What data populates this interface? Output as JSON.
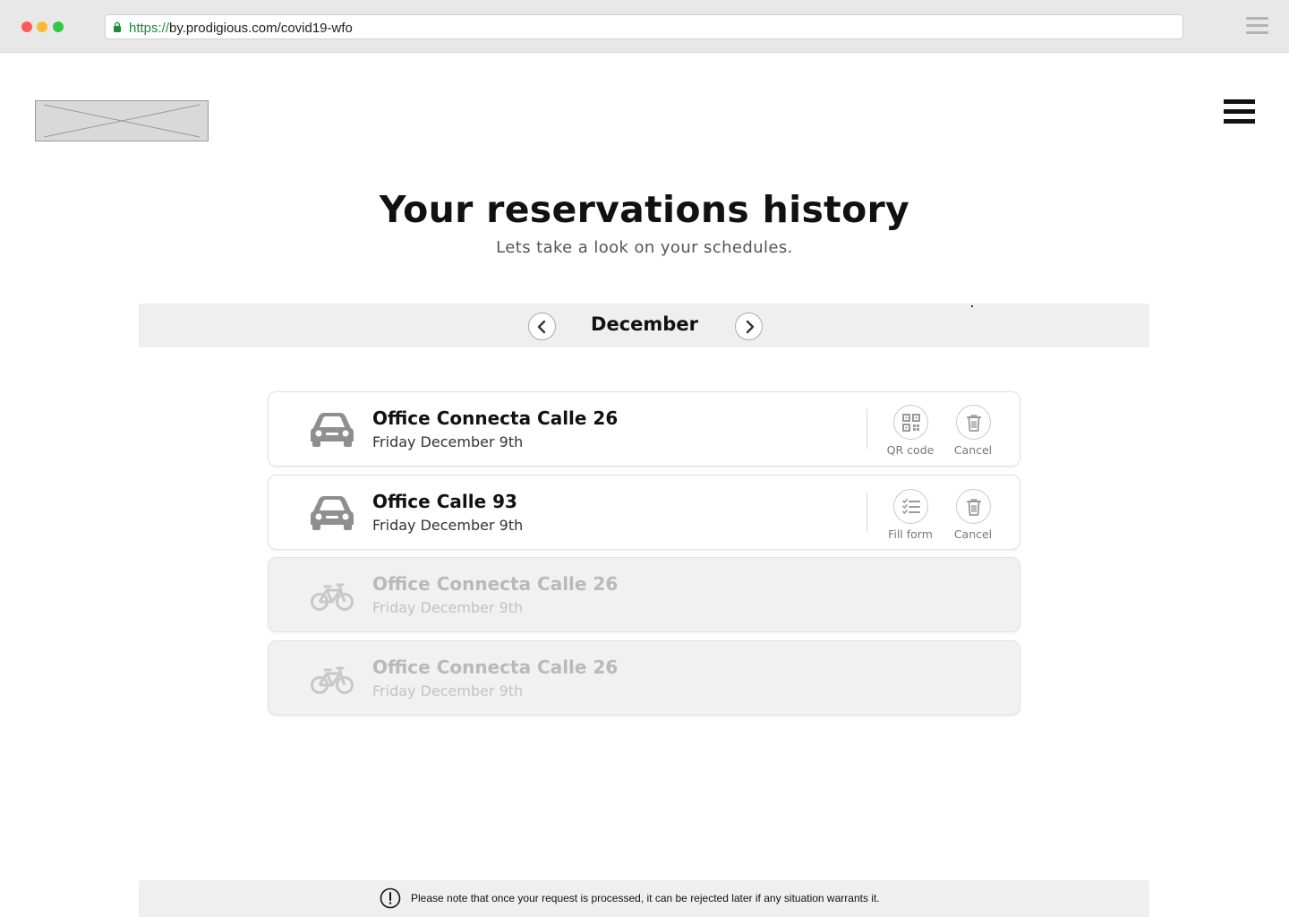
{
  "browser": {
    "url_scheme": "https://",
    "url_rest": "by.prodigious.com/covid19-wfo"
  },
  "header": {
    "logo_icon": "image-placeholder-icon",
    "menu_icon": "hamburger-menu-icon"
  },
  "page": {
    "title": "Your reservations history",
    "subtitle": "Lets take a look on your schedules."
  },
  "month_nav": {
    "month": "December",
    "prev_icon": "chevron-left-icon",
    "next_icon": "chevron-right-icon"
  },
  "reservations": [
    {
      "name": "Office Connecta Calle 26",
      "date": "Friday December 9th",
      "transport_icon": "car-icon",
      "active": true,
      "actions": [
        {
          "label": "QR code",
          "icon": "qr-code-icon"
        },
        {
          "label": "Cancel",
          "icon": "trash-icon"
        }
      ]
    },
    {
      "name": "Office Calle 93",
      "date": "Friday December 9th",
      "transport_icon": "car-icon",
      "active": true,
      "actions": [
        {
          "label": "Fill form",
          "icon": "checklist-icon"
        },
        {
          "label": "Cancel",
          "icon": "trash-icon"
        }
      ]
    },
    {
      "name": "Office Connecta Calle 26",
      "date": "Friday December 9th",
      "transport_icon": "bicycle-icon",
      "active": false,
      "actions": []
    },
    {
      "name": "Office Connecta Calle 26",
      "date": "Friday December 9th",
      "transport_icon": "bicycle-icon",
      "active": false,
      "actions": []
    }
  ],
  "footer": {
    "notice": "Please note that once your request is processed, it can be rejected later if any situation warrants it.",
    "notice_icon": "exclamation-circle-icon"
  },
  "colors": {
    "active_icon": "#8f8f8f",
    "disabled_icon": "#c8c8c8",
    "secure_url": "#1f8a3a"
  }
}
